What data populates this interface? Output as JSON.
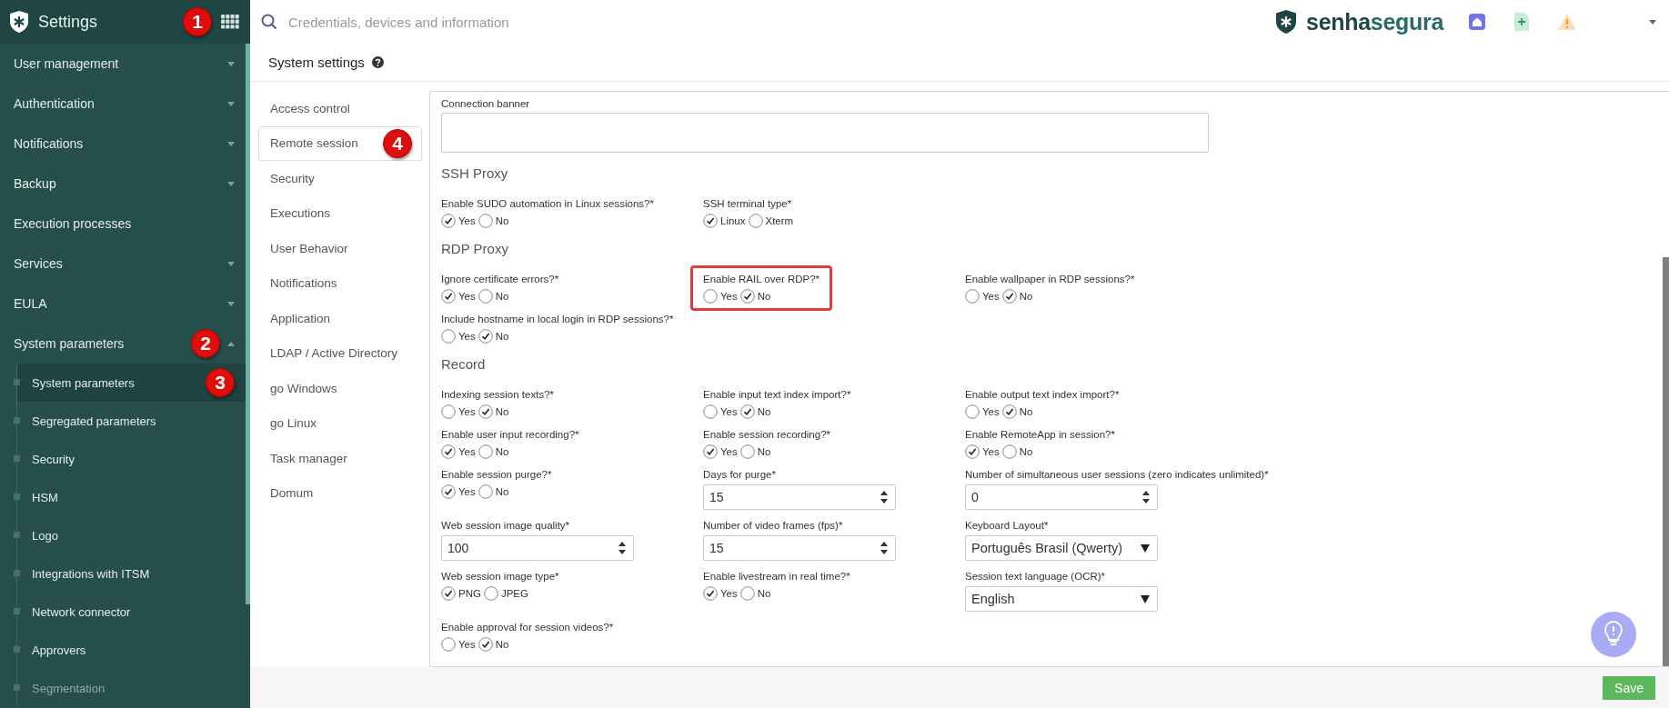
{
  "sidebar": {
    "title": "Settings",
    "callout": "1",
    "items": [
      {
        "label": "User management",
        "expanded": false
      },
      {
        "label": "Authentication",
        "expanded": false
      },
      {
        "label": "Notifications",
        "expanded": false
      },
      {
        "label": "Backup",
        "expanded": false
      },
      {
        "label": "Execution processes"
      },
      {
        "label": "Services",
        "expanded": false
      },
      {
        "label": "EULA",
        "expanded": false
      },
      {
        "label": "System parameters",
        "expanded": true,
        "callout": "2",
        "children": [
          {
            "label": "System parameters",
            "selected": true,
            "dimmed": false,
            "callout": "3"
          },
          {
            "label": "Segregated parameters",
            "selected": false,
            "dimmed": false
          },
          {
            "label": "Security",
            "selected": false,
            "dimmed": false
          },
          {
            "label": "HSM",
            "selected": false,
            "dimmed": false
          },
          {
            "label": "Logo",
            "selected": false,
            "dimmed": false
          },
          {
            "label": "Integrations with ITSM",
            "selected": false,
            "dimmed": false
          },
          {
            "label": "Network connector",
            "selected": false,
            "dimmed": false
          },
          {
            "label": "Approvers",
            "selected": false,
            "dimmed": false
          },
          {
            "label": "Segmentation",
            "selected": false,
            "dimmed": true
          }
        ]
      }
    ]
  },
  "search": {
    "placeholder": "Credentials, devices and information"
  },
  "brand": {
    "first": "senha",
    "second": "segura"
  },
  "page": {
    "title": "System settings"
  },
  "tabs": [
    {
      "label": "Access control",
      "selected": false
    },
    {
      "label": "Remote session",
      "selected": true,
      "callout": "4"
    },
    {
      "label": "Security",
      "selected": false
    },
    {
      "label": "Executions",
      "selected": false
    },
    {
      "label": "User Behavior",
      "selected": false
    },
    {
      "label": "Notifications",
      "selected": false
    },
    {
      "label": "Application",
      "selected": false
    },
    {
      "label": "LDAP / Active Directory",
      "selected": false
    },
    {
      "label": "go Windows",
      "selected": false
    },
    {
      "label": "go Linux",
      "selected": false
    },
    {
      "label": "Task manager",
      "selected": false
    },
    {
      "label": "Domum",
      "selected": false
    }
  ],
  "form": {
    "banner": {
      "label": "Connection banner",
      "kind": "textarea"
    },
    "sections": [
      {
        "title": "SSH Proxy",
        "rows": [
          [
            {
              "label": "Enable SUDO automation in Linux sessions?*",
              "kind": "radio",
              "options": [
                {
                  "label": "Yes",
                  "selected": true
                },
                {
                  "label": "No",
                  "selected": false
                }
              ]
            },
            {
              "label": "SSH terminal type*",
              "kind": "radio",
              "options": [
                {
                  "label": "Linux",
                  "selected": true
                },
                {
                  "label": "Xterm",
                  "selected": false
                }
              ]
            }
          ]
        ]
      },
      {
        "title": "RDP Proxy",
        "rows": [
          [
            {
              "label": "Ignore certificate errors?*",
              "kind": "radio",
              "options": [
                {
                  "label": "Yes",
                  "selected": true
                },
                {
                  "label": "No",
                  "selected": false
                }
              ]
            },
            {
              "label": "Enable RAIL over RDP?*",
              "kind": "radio",
              "highlighted": true,
              "options": [
                {
                  "label": "Yes",
                  "selected": false
                },
                {
                  "label": "No",
                  "selected": true
                }
              ]
            },
            {
              "label": "Enable wallpaper in RDP sessions?*",
              "kind": "radio",
              "options": [
                {
                  "label": "Yes",
                  "selected": false
                },
                {
                  "label": "No",
                  "selected": true
                }
              ]
            }
          ],
          [
            {
              "label": "Include hostname in local login in RDP sessions?*",
              "kind": "radio",
              "options": [
                {
                  "label": "Yes",
                  "selected": false
                },
                {
                  "label": "No",
                  "selected": true
                }
              ]
            }
          ]
        ]
      },
      {
        "title": "Record",
        "rows": [
          [
            {
              "label": "Indexing session texts?*",
              "kind": "radio",
              "options": [
                {
                  "label": "Yes",
                  "selected": false
                },
                {
                  "label": "No",
                  "selected": true
                }
              ]
            },
            {
              "label": "Enable input text index import?*",
              "kind": "radio",
              "options": [
                {
                  "label": "Yes",
                  "selected": false
                },
                {
                  "label": "No",
                  "selected": true
                }
              ]
            },
            {
              "label": "Enable output text index import?*",
              "kind": "radio",
              "options": [
                {
                  "label": "Yes",
                  "selected": false
                },
                {
                  "label": "No",
                  "selected": true
                }
              ]
            }
          ],
          [
            {
              "label": "Enable user input recording?*",
              "kind": "radio",
              "options": [
                {
                  "label": "Yes",
                  "selected": true
                },
                {
                  "label": "No",
                  "selected": false
                }
              ]
            },
            {
              "label": "Enable session recording?*",
              "kind": "radio",
              "options": [
                {
                  "label": "Yes",
                  "selected": true
                },
                {
                  "label": "No",
                  "selected": false
                }
              ]
            },
            {
              "label": "Enable RemoteApp in session?*",
              "kind": "radio",
              "options": [
                {
                  "label": "Yes",
                  "selected": true
                },
                {
                  "label": "No",
                  "selected": false
                }
              ]
            }
          ],
          [
            {
              "label": "Enable session purge?*",
              "kind": "radio",
              "options": [
                {
                  "label": "Yes",
                  "selected": true
                },
                {
                  "label": "No",
                  "selected": false
                }
              ]
            },
            {
              "label": "Days for purge*",
              "kind": "number",
              "value": "15"
            },
            {
              "label": "Number of simultaneous user sessions (zero indicates unlimited)*",
              "kind": "number",
              "value": "0"
            }
          ],
          [
            {
              "label": "Web session image quality*",
              "kind": "number",
              "value": "100"
            },
            {
              "label": "Number of video frames (fps)*",
              "kind": "number",
              "value": "15"
            },
            {
              "label": "Keyboard Layout*",
              "kind": "select",
              "value": "Português Brasil (Qwerty)"
            }
          ],
          [
            {
              "label": "Web session image type*",
              "kind": "radio",
              "options": [
                {
                  "label": "PNG",
                  "selected": true
                },
                {
                  "label": "JPEG",
                  "selected": false
                }
              ]
            },
            {
              "label": "Enable livestream in real time?*",
              "kind": "radio",
              "options": [
                {
                  "label": "Yes",
                  "selected": true
                },
                {
                  "label": "No",
                  "selected": false
                }
              ]
            },
            {
              "label": "Session text language (OCR)*",
              "kind": "select",
              "value": "English"
            }
          ],
          [
            {
              "label": "Enable approval for session videos?*",
              "kind": "radio",
              "options": [
                {
                  "label": "Yes",
                  "selected": false
                },
                {
                  "label": "No",
                  "selected": true
                }
              ]
            }
          ]
        ]
      }
    ]
  },
  "save_button": "Save"
}
